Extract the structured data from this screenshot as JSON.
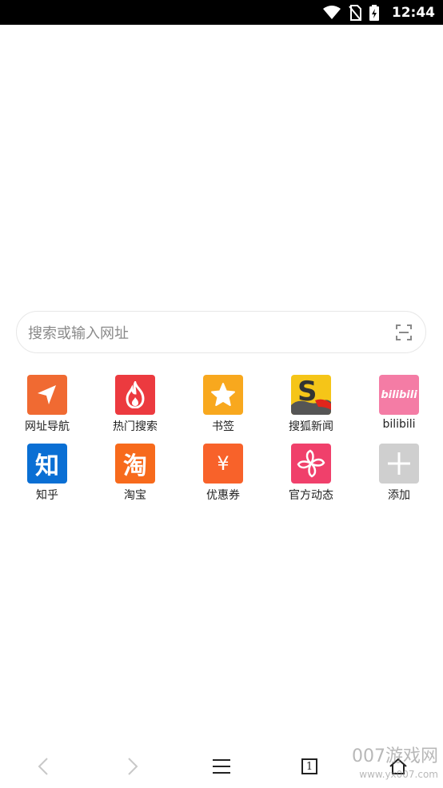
{
  "status_bar": {
    "time": "12:44",
    "icons": [
      "wifi-icon",
      "no-sim-icon",
      "battery-charging-icon"
    ]
  },
  "search": {
    "placeholder": "搜索或输入网址",
    "scan_icon": "scan-icon"
  },
  "shortcuts": [
    {
      "label": "网址导航",
      "icon": "navigation-arrow-icon",
      "color": "#f06a32"
    },
    {
      "label": "热门搜索",
      "icon": "flame-icon",
      "color": "#ec3a3f"
    },
    {
      "label": "书签",
      "icon": "star-icon",
      "color": "#f8a81e"
    },
    {
      "label": "搜狐新闻",
      "icon": "sohu-logo-icon",
      "color": "#f5c518"
    },
    {
      "label": "bilibili",
      "icon": "bilibili-logo-icon",
      "color": "#f47ca5",
      "logo_text": "bilibili"
    },
    {
      "label": "知乎",
      "icon": "zhihu-logo-icon",
      "color": "#0a6fd4",
      "logo_text": "知"
    },
    {
      "label": "淘宝",
      "icon": "taobao-logo-icon",
      "color": "#f76a1c",
      "logo_text": "淘"
    },
    {
      "label": "优惠券",
      "icon": "yen-icon",
      "color": "#f8622a",
      "logo_text": "¥"
    },
    {
      "label": "官方动态",
      "icon": "pinwheel-icon",
      "color": "#f0406b"
    },
    {
      "label": "添加",
      "icon": "plus-icon",
      "color": "#cfcfcf"
    }
  ],
  "bottom_nav": {
    "back_icon": "chevron-left-icon",
    "forward_icon": "chevron-right-icon",
    "menu_icon": "menu-icon",
    "tabs_count": "1",
    "home_icon": "home-icon"
  },
  "watermark": {
    "main": "007游戏网",
    "sub": "www.yx007.com"
  }
}
